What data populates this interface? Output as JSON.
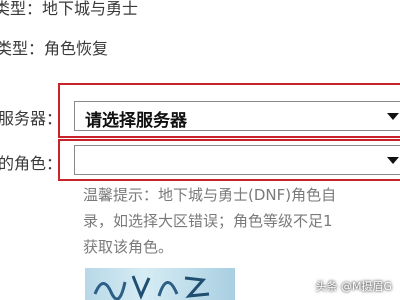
{
  "form": {
    "game_line": "类型：地下城与勇士",
    "service_line": "类型：角色恢复",
    "server_label": "服务器：",
    "server_select_value": "请选择服务器",
    "role_label": "的角色：",
    "role_select_value": ""
  },
  "hint": {
    "line1": "温馨提示：地下城与勇士(DNF)角色自",
    "line2": "录，如选择大区错误；角色等级不足1",
    "line3": "获取该角色。"
  },
  "watermark": "头条 @M摄眉G",
  "colors": {
    "highlight_border": "#c8222a",
    "hint_text": "#7a7a7a"
  },
  "icons": {
    "dropdown": "chevron-down-icon"
  }
}
